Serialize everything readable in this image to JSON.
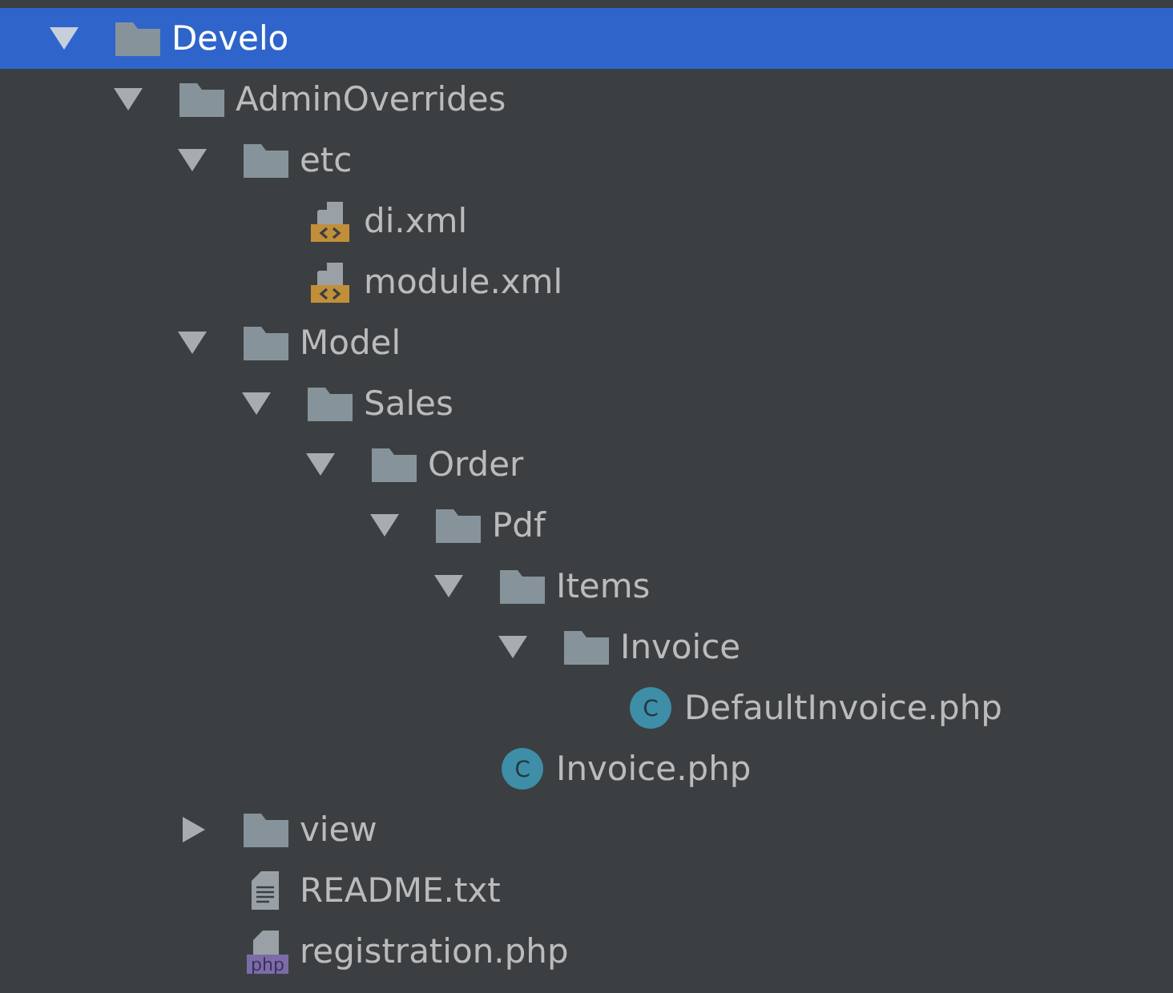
{
  "tree": [
    {
      "name": "Develo",
      "kind": "folder",
      "expanded": true,
      "selected": true,
      "children": [
        {
          "name": "AdminOverrides",
          "kind": "folder",
          "expanded": true,
          "selected": false,
          "children": [
            {
              "name": "etc",
              "kind": "folder",
              "expanded": true,
              "selected": false,
              "children": [
                {
                  "name": "di.xml",
                  "kind": "xml",
                  "selected": false
                },
                {
                  "name": "module.xml",
                  "kind": "xml",
                  "selected": false
                }
              ]
            },
            {
              "name": "Model",
              "kind": "folder",
              "expanded": true,
              "selected": false,
              "children": [
                {
                  "name": "Sales",
                  "kind": "folder",
                  "expanded": true,
                  "selected": false,
                  "children": [
                    {
                      "name": "Order",
                      "kind": "folder",
                      "expanded": true,
                      "selected": false,
                      "children": [
                        {
                          "name": "Pdf",
                          "kind": "folder",
                          "expanded": true,
                          "selected": false,
                          "children": [
                            {
                              "name": "Items",
                              "kind": "folder",
                              "expanded": true,
                              "selected": false,
                              "children": [
                                {
                                  "name": "Invoice",
                                  "kind": "folder",
                                  "expanded": true,
                                  "selected": false,
                                  "children": [
                                    {
                                      "name": "DefaultInvoice.php",
                                      "kind": "class",
                                      "badge": "C",
                                      "selected": false
                                    }
                                  ]
                                }
                              ]
                            },
                            {
                              "name": "Invoice.php",
                              "kind": "class",
                              "badge": "C",
                              "selected": false
                            }
                          ]
                        }
                      ]
                    }
                  ]
                }
              ]
            },
            {
              "name": "view",
              "kind": "folder",
              "expanded": false,
              "selected": false
            },
            {
              "name": "README.txt",
              "kind": "text",
              "selected": false
            },
            {
              "name": "registration.php",
              "kind": "php",
              "badge": "php",
              "selected": false
            }
          ]
        }
      ]
    }
  ]
}
